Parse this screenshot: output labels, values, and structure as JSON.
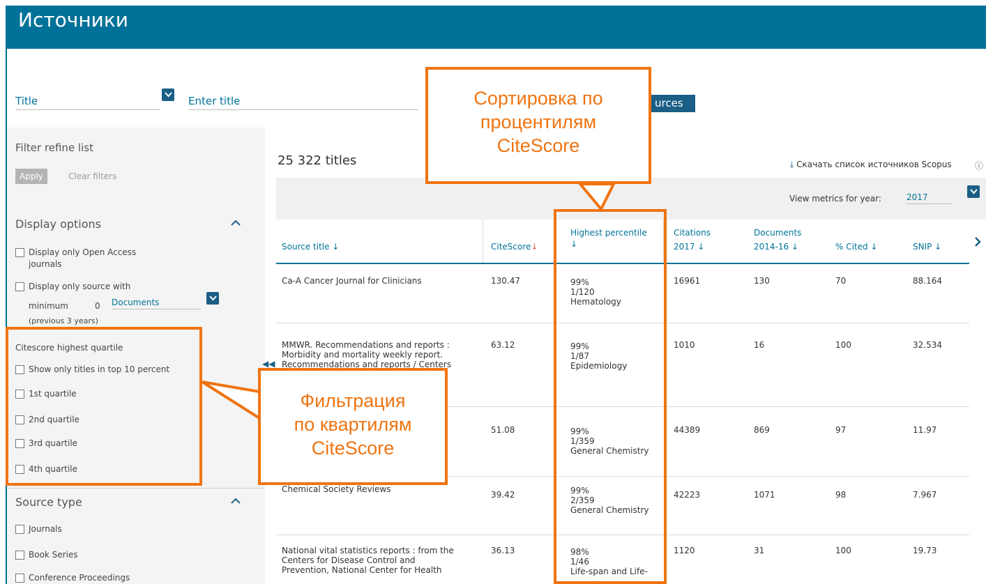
{
  "header": {
    "title": "Источники"
  },
  "search": {
    "field_label": "Title",
    "input_placeholder": "Enter title",
    "button_label": "urces"
  },
  "sidebar": {
    "filter_title": "Filter refine list",
    "apply_label": "Apply",
    "clear_label": "Clear filters",
    "display_options": {
      "heading": "Display options",
      "open_access": [
        "Display only Open Access",
        "journals"
      ],
      "min_source": {
        "prefix": "Display only source with",
        "minimum_label": "minimum",
        "minimum_value": "0",
        "select_value": "Documents",
        "note": "(previous 3 years)"
      }
    },
    "quartile": {
      "heading": "Citescore highest quartile",
      "items": [
        "Show only titles in top 10 percent",
        "1st quartile",
        "2nd quartile",
        "3rd quartile",
        "4th quartile"
      ]
    },
    "source_type": {
      "heading": "Source type",
      "items": [
        "Journals",
        "Book Series",
        "Conference Proceedings"
      ]
    }
  },
  "main": {
    "count": "25 322 titles",
    "download_label": "Скачать список источников Scopus",
    "metrics_label": "View metrics for year:",
    "metrics_year": "2017",
    "columns": {
      "source": "Source title ↓",
      "citescore": "CiteScore",
      "citescore_arrow": "↓",
      "percentile": [
        "Highest percentile",
        "↓"
      ],
      "citations": [
        "Citations",
        "2017 ↓"
      ],
      "documents": [
        "Documents",
        "2014-16 ↓"
      ],
      "cited": "% Cited ↓",
      "snip": "SNIP ↓"
    },
    "rows": [
      {
        "source": [
          "Ca-A Cancer Journal for Clinicians"
        ],
        "citescore": "130.47",
        "percentile": [
          "99%",
          "1/120",
          "Hematology"
        ],
        "citations": "16961",
        "documents": "130",
        "cited": "70",
        "snip": "88.164"
      },
      {
        "source": [
          "MMWR. Recommendations and reports :",
          "Morbidity and mortality weekly report.",
          "Recommendations and reports / Centers"
        ],
        "citescore": "63.12",
        "percentile": [
          "99%",
          "1/87",
          "Epidemiology"
        ],
        "citations": "1010",
        "documents": "16",
        "cited": "100",
        "snip": "32.534"
      },
      {
        "source": [],
        "citescore": "51.08",
        "percentile": [
          "99%",
          "1/359",
          "General Chemistry"
        ],
        "citations": "44389",
        "documents": "869",
        "cited": "97",
        "snip": "11.97"
      },
      {
        "source": [
          "Chemical Society Reviews"
        ],
        "citescore": "39.42",
        "percentile": [
          "99%",
          "2/359",
          "General Chemistry"
        ],
        "citations": "42223",
        "documents": "1071",
        "cited": "98",
        "snip": "7.967"
      },
      {
        "source": [
          "National vital statistics reports : from the",
          "Centers for Disease Control and",
          "Prevention, National Center for Health"
        ],
        "citescore": "36.13",
        "percentile": [
          "98%",
          "1/46",
          "Life-span and Life-"
        ],
        "citations": "1120",
        "documents": "31",
        "cited": "100",
        "snip": "19.73"
      }
    ]
  },
  "callouts": {
    "sort": [
      "Сортировка по",
      "процентилям",
      "CiteScore"
    ],
    "filter": [
      "Фильтрация",
      "по квартилям",
      "CiteScore"
    ]
  },
  "colors": {
    "header_bg": "#007198",
    "link": "#007398",
    "accent_orange": "#ef7411",
    "button_dark": "#1b5e86",
    "sort_arrow_red": "#e2593b"
  }
}
